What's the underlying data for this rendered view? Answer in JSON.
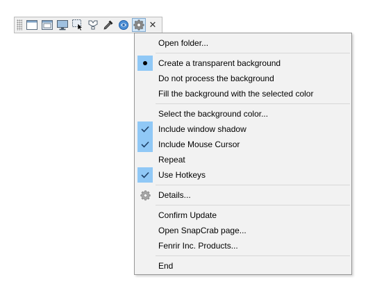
{
  "toolbar": {
    "icons": [
      "window-capture-icon",
      "window-client-capture-icon",
      "fullscreen-capture-icon",
      "region-capture-icon",
      "web-capture-icon",
      "color-picker-icon",
      "browser-icon",
      "settings-icon"
    ],
    "active_icon": "settings-icon",
    "close_glyph": "✕"
  },
  "menu": {
    "items": [
      {
        "label": "Open folder..."
      },
      {
        "label": "Create a transparent background",
        "mark": "radio"
      },
      {
        "label": "Do not process the background"
      },
      {
        "label": "Fill the background with the selected color"
      },
      {
        "label": "Select the background color..."
      },
      {
        "label": "Include window shadow",
        "mark": "check"
      },
      {
        "label": "Include Mouse Cursor",
        "mark": "check"
      },
      {
        "label": "Repeat"
      },
      {
        "label": "Use Hotkeys",
        "mark": "check"
      },
      {
        "label": "Details...",
        "icon": "gear-icon"
      },
      {
        "label": "Confirm Update"
      },
      {
        "label": "Open SnapCrab page..."
      },
      {
        "label": "Fenrir Inc. Products..."
      },
      {
        "label": "End"
      }
    ]
  },
  "colors": {
    "menu_background": "#f2f2f2",
    "check_highlight": "#90c8f6",
    "toolbar_active": "#cfe5f8"
  }
}
